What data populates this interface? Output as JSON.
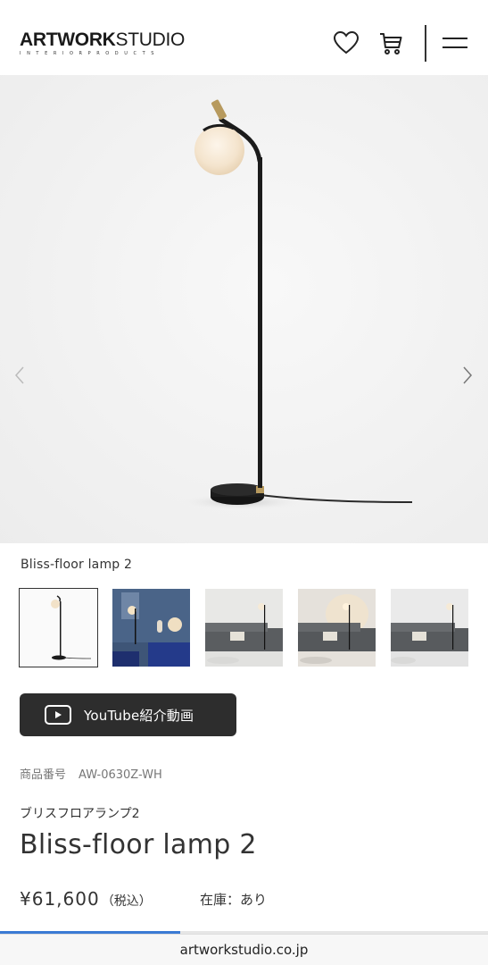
{
  "header": {
    "logo_bold": "ARTWORK",
    "logo_thin": "STUDIO",
    "logo_sub": "INTERIORPRODUCTS",
    "icons": [
      "heart-icon",
      "cart-icon",
      "hamburger-menu-icon"
    ]
  },
  "gallery": {
    "product_caption": "Bliss-floor lamp 2",
    "prev_icon": "chevron-left-icon",
    "next_icon": "chevron-right-icon",
    "thumbnails": 5,
    "active_thumbnail": 1
  },
  "video_button": {
    "label": "YouTube紹介動画",
    "icon": "play-icon"
  },
  "product": {
    "sku_label": "商品番号",
    "sku": "AW-0630Z-WH",
    "name_kana": "ブリスフロアランプ2",
    "name": "Bliss-floor lamp 2",
    "price": "¥61,600",
    "tax_note": "（税込）",
    "stock": "在庫：あり"
  },
  "browser": {
    "url": "artworkstudio.co.jp",
    "load_progress": 0.37
  },
  "colors": {
    "accent_progress": "#3b7bd4",
    "button_bg": "#2d2d2d"
  }
}
